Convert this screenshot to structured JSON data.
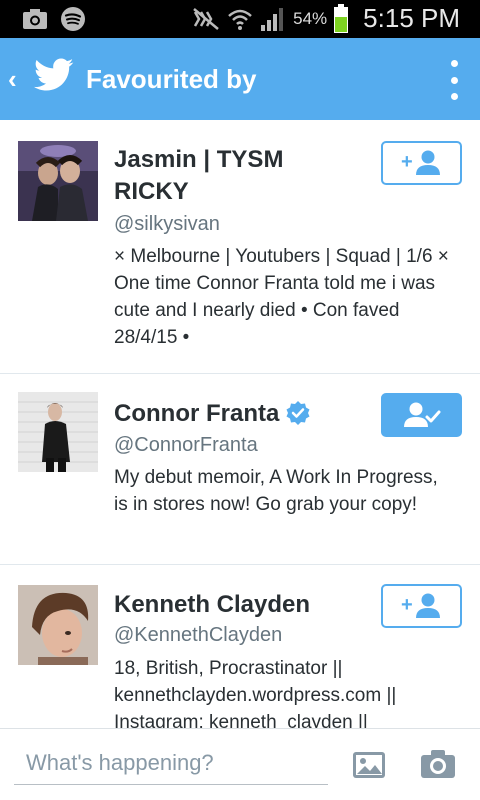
{
  "status_bar": {
    "battery_percent": "54%",
    "time": "5:15 PM"
  },
  "appbar": {
    "back_glyph": "‹",
    "title": "Favourited by",
    "overflow_icon": "overflow-menu-icon"
  },
  "users": [
    {
      "name": "Jasmin | TYSM RICKY",
      "handle": "@silkysivan",
      "bio": "× Melbourne | Youtubers | Squad | 1/6 × One time Connor Franta told me i was cute and I nearly died • Con faved 28/4/15 •",
      "verified": false,
      "following": false
    },
    {
      "name": "Connor Franta",
      "handle": "@ConnorFranta",
      "bio": "My debut memoir, A Work In Progress, is in stores now! Go grab your copy!",
      "verified": true,
      "following": true
    },
    {
      "name": "Kenneth Clayden",
      "handle": "@KennethClayden",
      "bio": "18, British, Procrastinator || kennethclayden.wordpress.com || Instagram: kenneth_clayden ||",
      "verified": false,
      "following": false
    }
  ],
  "composer": {
    "placeholder": "What's happening?"
  },
  "colors": {
    "accent": "#55acee",
    "status_bar": "#000000",
    "battery": "#7ed321"
  }
}
